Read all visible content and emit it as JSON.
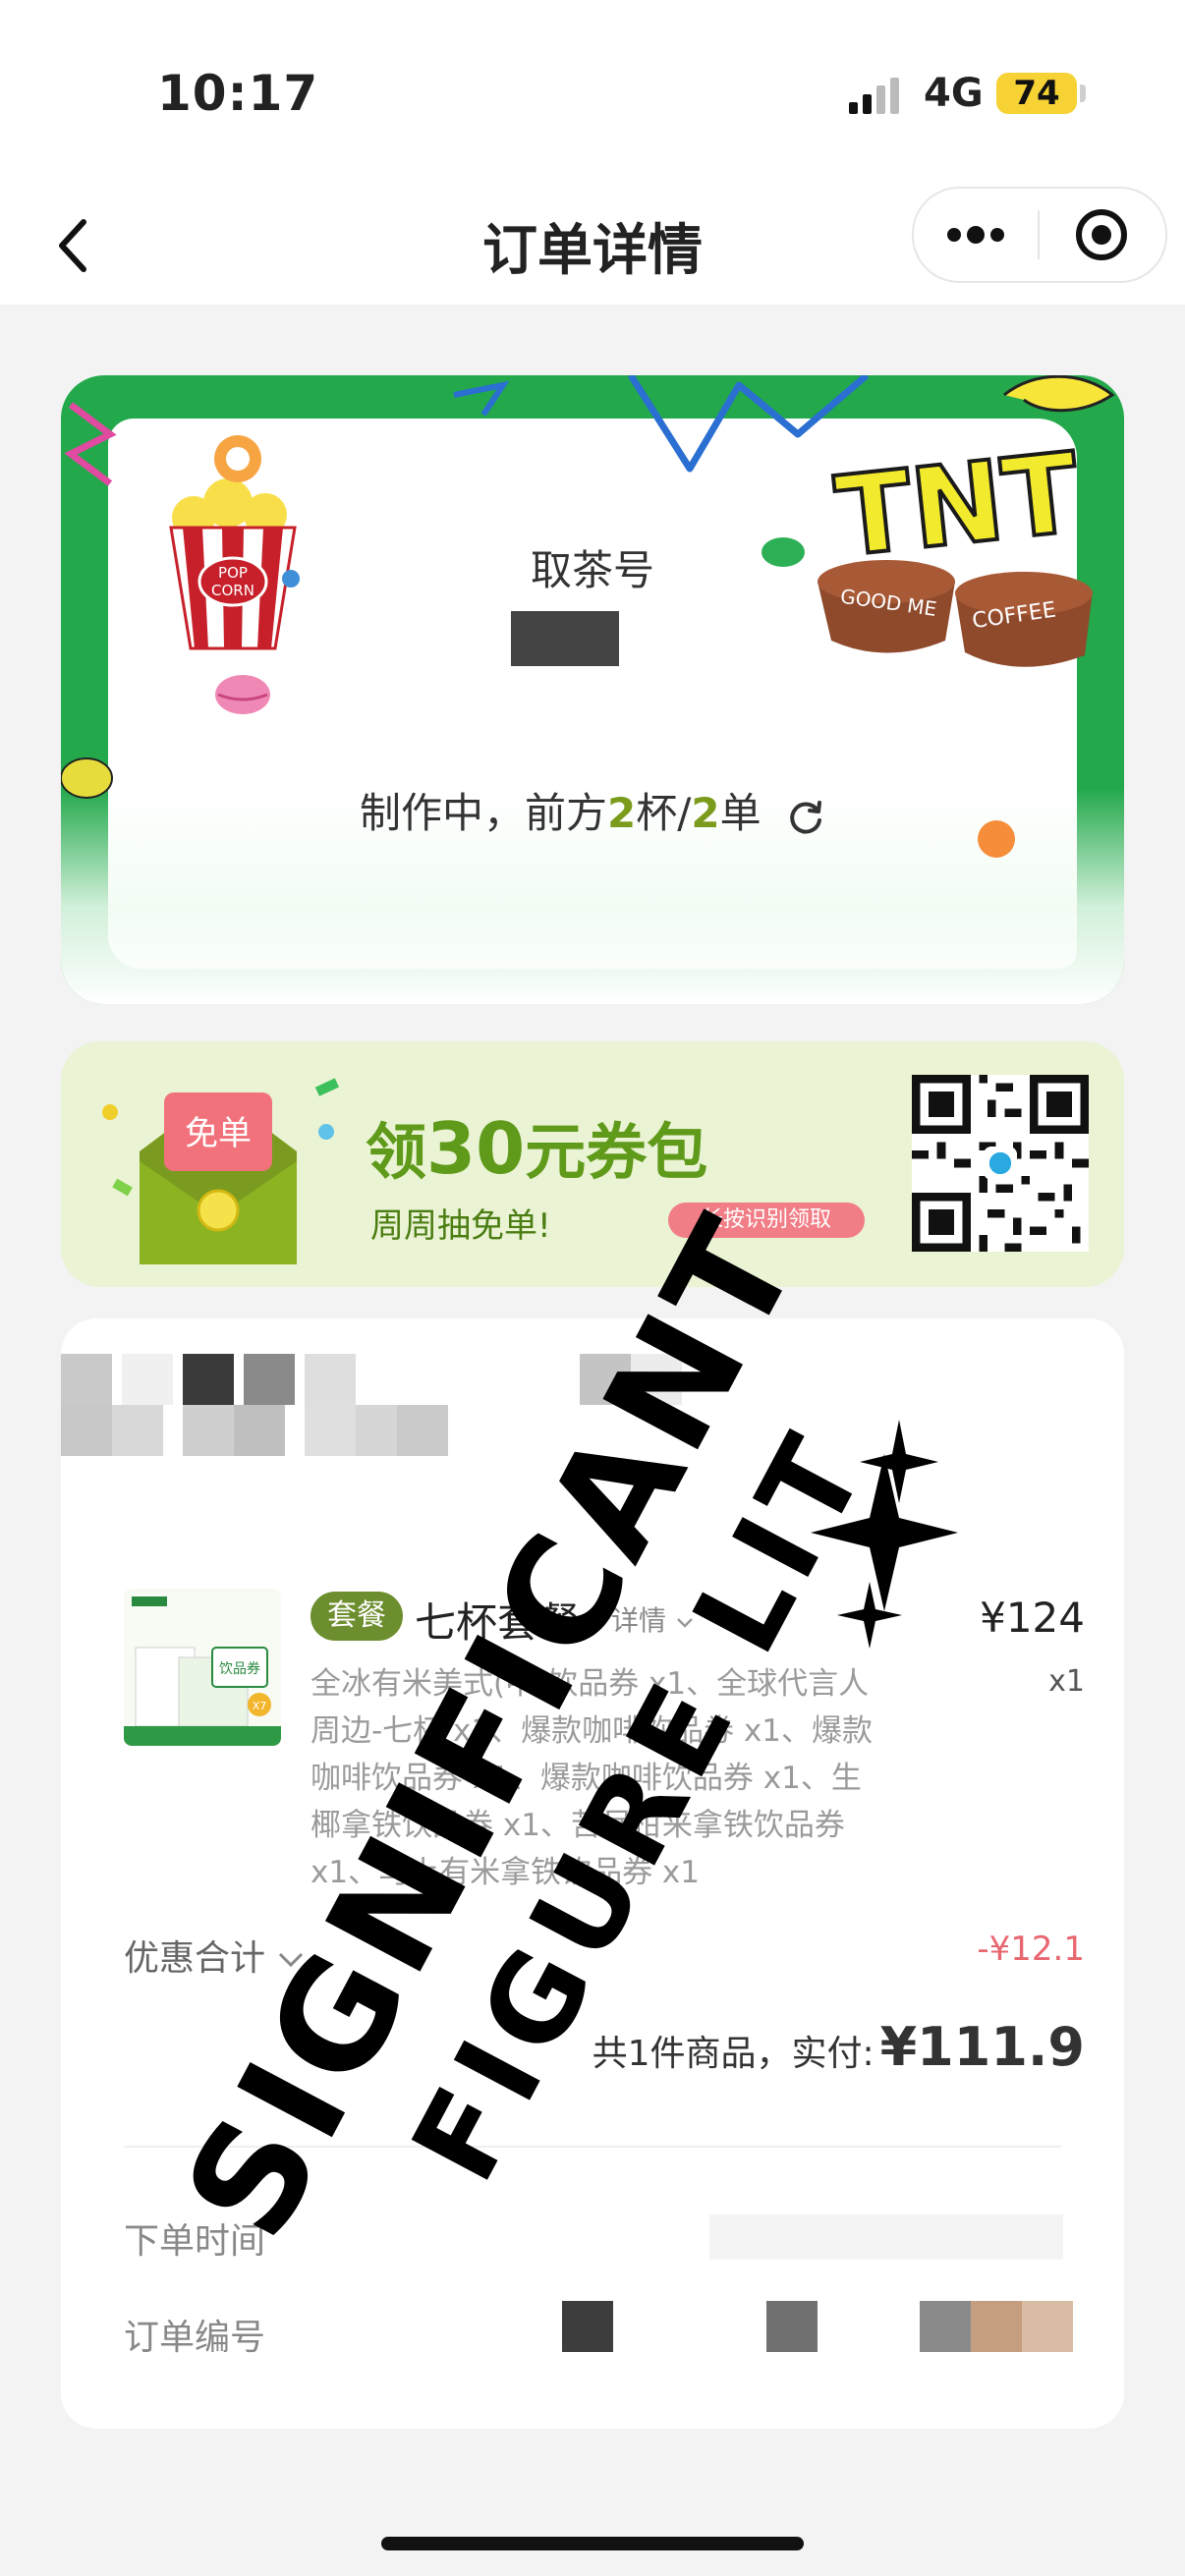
{
  "status_bar": {
    "time": "10:17",
    "network": "4G",
    "battery": "74"
  },
  "nav": {
    "title": "订单详情",
    "back_icon": "chevron-left-icon",
    "more_icon": "more-dots-icon",
    "close_icon": "target-circle-icon"
  },
  "tea_card": {
    "label": "取茶号",
    "status_prefix": "制作中，前方",
    "cups": "2",
    "cups_unit": "杯/",
    "orders": "2",
    "orders_unit": "单",
    "decor": {
      "sign_text": "TNT",
      "cup_left": "GOOD ME",
      "cup_right": "COFFEE",
      "popcorn": "POP CORN"
    },
    "colors": {
      "frame": "#23a84c",
      "highlight": "#7b9b1d"
    }
  },
  "promo": {
    "envelope_label": "免单",
    "title_prefix": "领",
    "title_number": "30",
    "title_suffix": "元券包",
    "subtitle": "周周抽免单!",
    "pill": "长按识别领取"
  },
  "order": {
    "item": {
      "tag": "套餐",
      "name": "七杯套餐",
      "detail_link": "详情",
      "price": "¥124",
      "qty": "x1",
      "description": "全冰有米美式(中)饮品券 x1、全球代言人周边-七杯 x1、爆款咖啡饮品券 x1、爆款咖啡饮品券 x1、爆款咖啡饮品券 x1、生椰拿铁饮品券 x1、苦尽柑来拿铁饮品券 x1、马上有米拿铁饮品券 x1",
      "image_texts": {
        "badge": "饮品券",
        "count": "X7"
      }
    },
    "discount_label": "优惠合计",
    "discount_value": "-¥12.1",
    "summary_prefix": "共1件商品，实付:",
    "total": "¥111.9",
    "order_time_label": "下单时间",
    "order_number_label": "订单编号"
  },
  "watermark": {
    "line1": "SIGNIFICANT",
    "line2": "FIGURE LIT"
  }
}
